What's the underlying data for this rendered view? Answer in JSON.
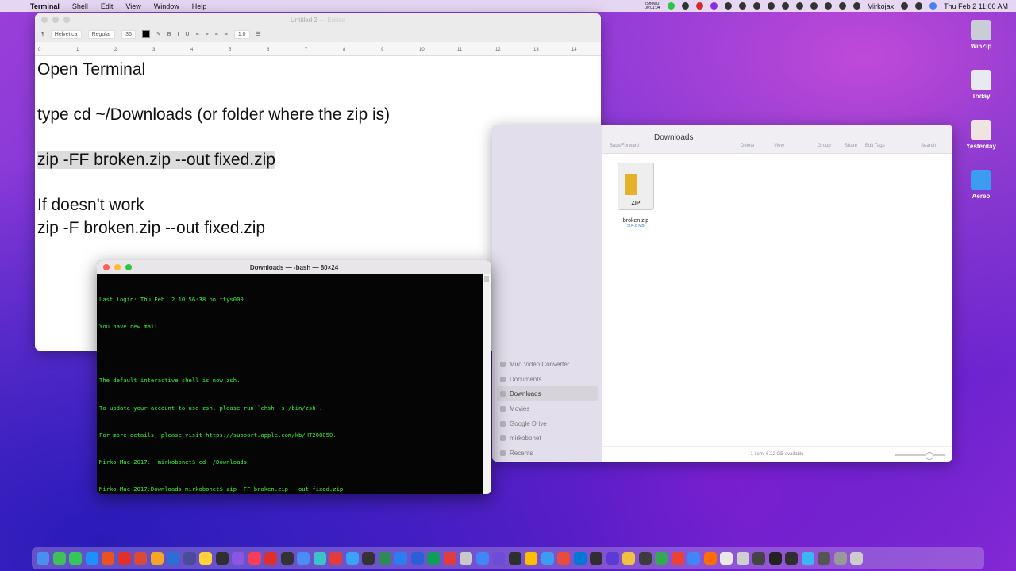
{
  "menubar": {
    "apple_glyph": "",
    "items": [
      "Terminal",
      "Shell",
      "Edit",
      "View",
      "Window",
      "Help"
    ],
    "recorder_line1": "iShowU",
    "recorder_line2": "00:01:04",
    "user": "Mirkojax",
    "datetime": "Thu Feb 2  11:00 AM"
  },
  "desktop_icons": [
    {
      "label": "WinZip",
      "color": "#c8cdd6"
    },
    {
      "label": "Today",
      "color": "#e7eaf0"
    },
    {
      "label": "Yesterday",
      "color": "#f0e3e3"
    },
    {
      "label": "Aereo",
      "color": "#3b9cf0"
    }
  ],
  "textedit": {
    "title": "Untitled 2",
    "edited": "— Edited",
    "toolbar": {
      "paragraph": "¶",
      "font": "Helvetica",
      "style": "Regular",
      "size": "36",
      "spacing": "1.0"
    },
    "ruler": [
      "0",
      "1",
      "2",
      "3",
      "4",
      "5",
      "6",
      "7",
      "8",
      "9",
      "10",
      "11",
      "12",
      "13",
      "14"
    ],
    "lines": [
      "Open Terminal",
      "",
      "type cd ~/Downloads (or folder where the zip is)",
      "",
      "zip -FF broken.zip --out fixed.zip",
      "",
      "If doesn't work",
      "zip -F broken.zip --out fixed.zip"
    ]
  },
  "finder": {
    "title": "Downloads",
    "toolbar": {
      "back_forward": "Back/Forward",
      "delete": "Delete",
      "view": "View",
      "group": "Group",
      "share": "Share",
      "edit_tags": "Edit Tags",
      "search": "Search"
    },
    "sidebar": [
      "Miro Video Converter",
      "Documents",
      "Downloads",
      "Movies",
      "Google Drive",
      "mirkobonet",
      "Recents"
    ],
    "active_sidebar": "Downloads",
    "file": {
      "name": "broken.zip",
      "size": "504.8 MB",
      "icon_text": "ZIP"
    },
    "status": "1 item, 6.22 GB available"
  },
  "terminal": {
    "title": "Downloads — -bash — 80×24",
    "lines": [
      "Last login: Thu Feb  2 10:56:38 on ttys000",
      "You have new mail.",
      "",
      "The default interactive shell is now zsh.",
      "To update your account to use zsh, please run `chsh -s /bin/zsh`.",
      "For more details, please visit https://support.apple.com/kb/HT208050.",
      "Mirko-Mac-2017:~ mirkobonet$ cd ~/Downloads",
      "Mirko-Mac-2017:Downloads mirkobonet$ zip -FF broken.zip --out fixed.zip_"
    ]
  },
  "dock": {
    "colors": [
      "#4a8ef0",
      "#3fc15a",
      "#35c759",
      "#1e90ff",
      "#e8531f",
      "#e0302a",
      "#d94a3a",
      "#f5a623",
      "#2b6ed6",
      "#4b4b9a",
      "#ffd23a",
      "#2f2f2f",
      "#8a56e2",
      "#fa3c5a",
      "#e02e2e",
      "#333",
      "#4c8cf5",
      "#3ac4c9",
      "#e23c3c",
      "#39a3f5",
      "#333",
      "#2e8b57",
      "#2a7ef0",
      "#2b5fd9",
      "#0f9d58",
      "#e23c3c",
      "#c9c9c9",
      "#4285f4",
      "#6f4bd9",
      "#2f2f2f",
      "#ffbf00",
      "#3b9cf0",
      "#e74c3c",
      "#0078d4",
      "#2f2f2f",
      "#5b3ad6",
      "#f0c040",
      "#3c3c3c",
      "#34a853",
      "#ea4335",
      "#4285f4",
      "#ff6d01",
      "#e8e8e8",
      "#cfcfcf",
      "#444",
      "#222",
      "#2f2f2f",
      "#3ab7f0",
      "#555",
      "#999",
      "#ccc"
    ]
  }
}
